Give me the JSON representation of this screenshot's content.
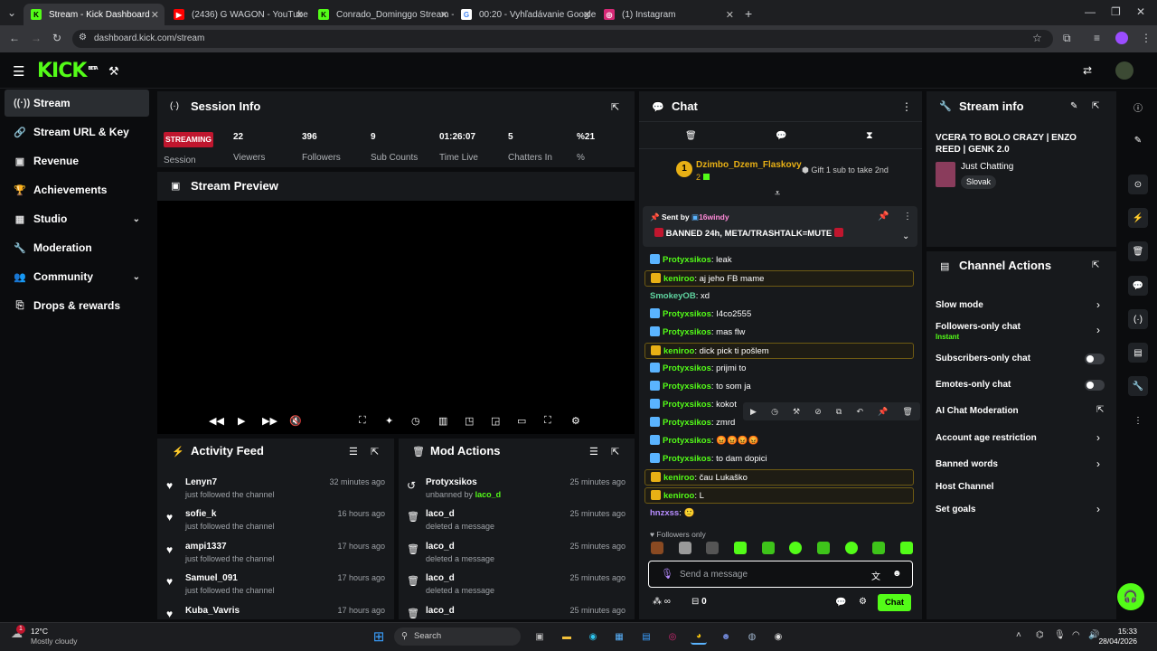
{
  "browser": {
    "tabs": [
      {
        "title": "Stream - Kick Dashboard",
        "active": true
      },
      {
        "title": "(2436) G WAGON - YouTube",
        "active": false
      },
      {
        "title": "Conrado_Dominggo Stream - V",
        "active": false
      },
      {
        "title": "00:20 - Vyhľadávanie Google",
        "active": false
      },
      {
        "title": "(1) Instagram",
        "active": false
      }
    ],
    "url": "dashboard.kick.com/stream"
  },
  "brand": {
    "logo": "KICK",
    "logo_sup": "BETA",
    "accent": "#53fc18"
  },
  "sidebar": {
    "items": [
      {
        "label": "Stream",
        "icon": "broadcast-icon"
      },
      {
        "label": "Stream URL & Key",
        "icon": "link-icon"
      },
      {
        "label": "Revenue",
        "icon": "revenue-icon"
      },
      {
        "label": "Achievements",
        "icon": "trophy-icon"
      },
      {
        "label": "Studio",
        "icon": "studio-icon"
      },
      {
        "label": "Moderation",
        "icon": "wrench-icon"
      },
      {
        "label": "Community",
        "icon": "community-icon"
      },
      {
        "label": "Drops & rewards",
        "icon": "drops-icon"
      }
    ]
  },
  "session": {
    "title": "Session Info",
    "status": "STREAMING",
    "status_label": "Session",
    "stats": [
      {
        "value": "22",
        "label": "Viewers"
      },
      {
        "value": "396",
        "label": "Followers"
      },
      {
        "value": "9",
        "label": "Sub Counts"
      },
      {
        "value": "01:26:07",
        "label": "Time Live"
      },
      {
        "value": "5",
        "label": "Chatters In"
      },
      {
        "value": "%21",
        "label": "%"
      }
    ]
  },
  "preview": {
    "title": "Stream Preview"
  },
  "activity": {
    "title": "Activity Feed",
    "rows": [
      {
        "name": "Lenyn7",
        "sub": "just followed the channel",
        "time": "32 minutes ago"
      },
      {
        "name": "sofie_k",
        "sub": "just followed the channel",
        "time": "16 hours ago"
      },
      {
        "name": "ampi1337",
        "sub": "just followed the channel",
        "time": "17 hours ago"
      },
      {
        "name": "Samuel_091",
        "sub": "just followed the channel",
        "time": "17 hours ago"
      },
      {
        "name": "Kuba_Vavris",
        "sub": "",
        "time": "17 hours ago"
      }
    ]
  },
  "modactions": {
    "title": "Mod Actions",
    "rows": [
      {
        "name": "Protyxsikos",
        "sub": "unbanned by",
        "by": "laco_d",
        "time": "25 minutes ago"
      },
      {
        "name": "laco_d",
        "sub": "deleted a message",
        "by": "",
        "time": "25 minutes ago"
      },
      {
        "name": "laco_d",
        "sub": "deleted a message",
        "by": "",
        "time": "25 minutes ago"
      },
      {
        "name": "laco_d",
        "sub": "deleted a message",
        "by": "",
        "time": "25 minutes ago"
      },
      {
        "name": "laco_d",
        "sub": "",
        "by": "",
        "time": "25 minutes ago"
      }
    ]
  },
  "chat": {
    "title": "Chat",
    "gift_user": "Dzimbo_Dzem_Flaskovy",
    "gift_count": "2",
    "gift_rank": "1",
    "gift_cta": "Gift 1 sub to take 2nd",
    "pinned_by_label": "Sent by",
    "pinned_by": "16windy",
    "pinned_text": "BANNED 24h, META/TRASHTALK=MUTE",
    "messages": [
      {
        "user": "Protyxsikos",
        "text": ": leak",
        "color": "#53fc18",
        "hl": false
      },
      {
        "user": "keniroo",
        "text": ": aj jeho FB mame",
        "color": "#53fc18",
        "hl": true
      },
      {
        "user": "SmokeyOB",
        "text": ": xd",
        "color": "#5fd4a0",
        "hl": false
      },
      {
        "user": "Protyxsikos",
        "text": ": I4co2555",
        "color": "#53fc18",
        "hl": false
      },
      {
        "user": "Protyxsikos",
        "text": ": mas flw",
        "color": "#53fc18",
        "hl": false
      },
      {
        "user": "keniroo",
        "text": ": dick pick ti pošlem",
        "color": "#53fc18",
        "hl": true
      },
      {
        "user": "Protyxsikos",
        "text": ": prijmi to",
        "color": "#53fc18",
        "hl": false
      },
      {
        "user": "Protyxsikos",
        "text": ": to som ja",
        "color": "#53fc18",
        "hl": false
      },
      {
        "user": "Protyxsikos",
        "text": ": kokot",
        "color": "#53fc18",
        "hl": false
      },
      {
        "user": "Protyxsikos",
        "text": ": zmrd",
        "color": "#53fc18",
        "hl": false
      },
      {
        "user": "Protyxsikos",
        "text": ": 😡😡😡😡",
        "color": "#53fc18",
        "hl": false
      },
      {
        "user": "Protyxsikos",
        "text": ": to dam dopici",
        "color": "#53fc18",
        "hl": false
      },
      {
        "user": "keniroo",
        "text": ": čau Lukaško",
        "color": "#53fc18",
        "hl": true
      },
      {
        "user": "keniroo",
        "text": ": L",
        "color": "#53fc18",
        "hl": true
      },
      {
        "user": "hnzxss",
        "text": ": 🙂",
        "color": "#b78cff",
        "hl": false
      }
    ],
    "followers_only": "Followers only",
    "placeholder": "Send a message",
    "points": "0",
    "send": "Chat"
  },
  "streaminfo": {
    "title": "Stream info",
    "stream_title": "VCERA TO BOLO CRAZY | ENZO REED | GENK 2.0",
    "category": "Just Chatting",
    "tag": "Slovak"
  },
  "channel_actions": {
    "title": "Channel Actions",
    "items": [
      {
        "label": "Slow mode",
        "sub": "",
        "ctrl": "chevron"
      },
      {
        "label": "Followers-only chat",
        "sub": "Instant",
        "ctrl": "chevron"
      },
      {
        "label": "Subscribers-only chat",
        "sub": "",
        "ctrl": "toggle"
      },
      {
        "label": "Emotes-only chat",
        "sub": "",
        "ctrl": "toggle"
      },
      {
        "label": "AI Chat Moderation",
        "sub": "",
        "ctrl": "external"
      },
      {
        "label": "Account age restriction",
        "sub": "",
        "ctrl": "chevron"
      },
      {
        "label": "Banned words",
        "sub": "",
        "ctrl": "chevron"
      },
      {
        "label": "Host Channel",
        "sub": "",
        "ctrl": "none"
      },
      {
        "label": "Set goals",
        "sub": "",
        "ctrl": "chevron"
      }
    ]
  },
  "taskbar": {
    "weather_temp": "12°C",
    "weather_desc": "Mostly cloudy",
    "search": "Search",
    "time": "15:33",
    "date": "28/04/2026"
  }
}
